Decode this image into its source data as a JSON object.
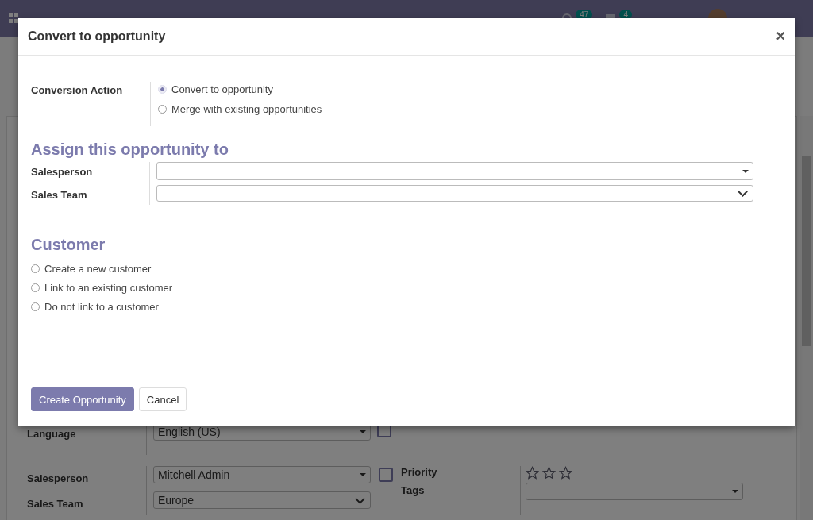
{
  "navbar": {
    "activity_count": "47",
    "message_count": "4"
  },
  "form": {
    "language": {
      "label": "Language",
      "value": "English (US)"
    },
    "salesperson": {
      "label": "Salesperson",
      "value": "Mitchell Admin"
    },
    "sales_team": {
      "label": "Sales Team",
      "value": "Europe"
    },
    "priority": {
      "label": "Priority",
      "stars": 0
    },
    "tags": {
      "label": "Tags"
    }
  },
  "dialog": {
    "title": "Convert to opportunity",
    "close": "×",
    "conversion": {
      "label": "Conversion Action",
      "options": [
        {
          "label": "Convert to opportunity",
          "selected": true
        },
        {
          "label": "Merge with existing opportunities",
          "selected": false
        }
      ]
    },
    "assign": {
      "heading": "Assign this opportunity to",
      "fields": [
        {
          "label": "Salesperson",
          "kind": "many2one"
        },
        {
          "label": "Sales Team",
          "kind": "select"
        }
      ]
    },
    "customer": {
      "heading": "Customer",
      "options": [
        {
          "label": "Create a new customer",
          "selected": false
        },
        {
          "label": "Link to an existing customer",
          "selected": false
        },
        {
          "label": "Do not link to a customer",
          "selected": false
        }
      ]
    },
    "buttons": [
      {
        "label": "Create Opportunity",
        "kind": "primary"
      },
      {
        "label": "Cancel",
        "kind": "secondary"
      }
    ]
  }
}
